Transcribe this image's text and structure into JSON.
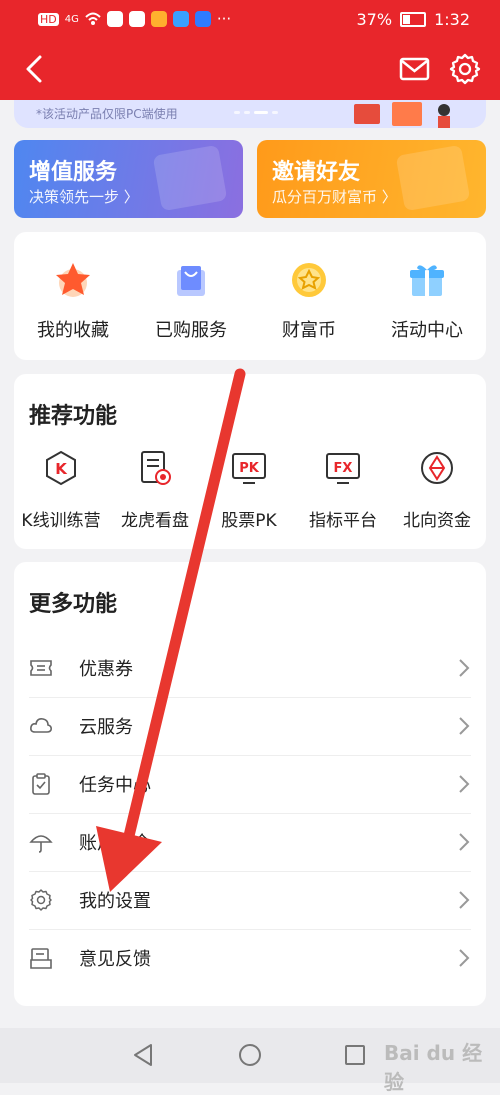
{
  "status_bar": {
    "battery": "37%",
    "time": "1:32",
    "signal_label": "HD",
    "network": "4G"
  },
  "banner": {
    "note": "*该活动产品仅限PC端使用"
  },
  "promos": [
    {
      "title": "增值服务",
      "subtitle": "决策领先一步 〉"
    },
    {
      "title": "邀请好友",
      "subtitle": "瓜分百万财富币 〉"
    }
  ],
  "quick_icons": [
    {
      "label": "我的收藏",
      "icon": "star-icon"
    },
    {
      "label": "已购服务",
      "icon": "shopping-bag-icon"
    },
    {
      "label": "财富币",
      "icon": "coin-icon"
    },
    {
      "label": "活动中心",
      "icon": "gift-icon"
    }
  ],
  "recommended": {
    "title": "推荐功能",
    "items": [
      {
        "label": "K线训练营",
        "icon": "k-line-icon",
        "glyph": "K"
      },
      {
        "label": "龙虎看盘",
        "icon": "dragon-tiger-icon",
        "glyph": ""
      },
      {
        "label": "股票PK",
        "icon": "pk-icon",
        "glyph": "PK"
      },
      {
        "label": "指标平台",
        "icon": "fx-icon",
        "glyph": "FX"
      },
      {
        "label": "北向资金",
        "icon": "northbound-icon",
        "glyph": ""
      }
    ]
  },
  "more": {
    "title": "更多功能",
    "items": [
      {
        "label": "优惠券",
        "icon": "coupon-icon"
      },
      {
        "label": "云服务",
        "icon": "cloud-icon"
      },
      {
        "label": "任务中心",
        "icon": "task-icon"
      },
      {
        "label": "账户安全",
        "icon": "umbrella-icon"
      },
      {
        "label": "我的设置",
        "icon": "settings-icon"
      },
      {
        "label": "意见反馈",
        "icon": "feedback-icon"
      }
    ]
  },
  "watermark": "Bai du 经验",
  "colors": {
    "header": "#e8262b",
    "arrow": "#e8372f"
  }
}
